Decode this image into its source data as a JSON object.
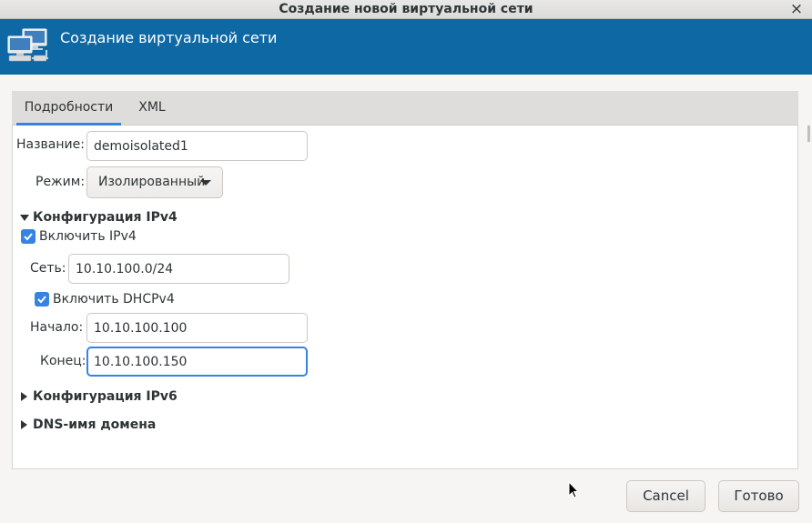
{
  "window": {
    "title": "Создание новой виртуальной сети",
    "close_icon": "×"
  },
  "header": {
    "title": "Создание виртуальной сети",
    "icon": "network-icon",
    "bg_color": "#0d68a4"
  },
  "tabs": [
    {
      "label": "Подробности",
      "active": true
    },
    {
      "label": "XML",
      "active": false
    }
  ],
  "form": {
    "name_label": "Название:",
    "name_value": "demoisolated1",
    "mode_label": "Режим:",
    "mode_value": "Изолированный"
  },
  "ipv4": {
    "header": "Конфигурация IPv4",
    "expanded": true,
    "enable_label": "Включить IPv4",
    "enable_checked": true,
    "network_label": "Сеть:",
    "network_value": "10.10.100.0/24",
    "dhcp_label": "Включить DHCPv4",
    "dhcp_checked": true,
    "start_label": "Начало:",
    "start_value": "10.10.100.100",
    "end_label": "Конец:",
    "end_value": "10.10.100.150"
  },
  "ipv6": {
    "header": "Конфигурация IPv6",
    "expanded": false
  },
  "dns": {
    "header": "DNS-имя домена",
    "expanded": false
  },
  "buttons": {
    "cancel": "Cancel",
    "finish": "Готово"
  },
  "accent_color": "#3584e4"
}
